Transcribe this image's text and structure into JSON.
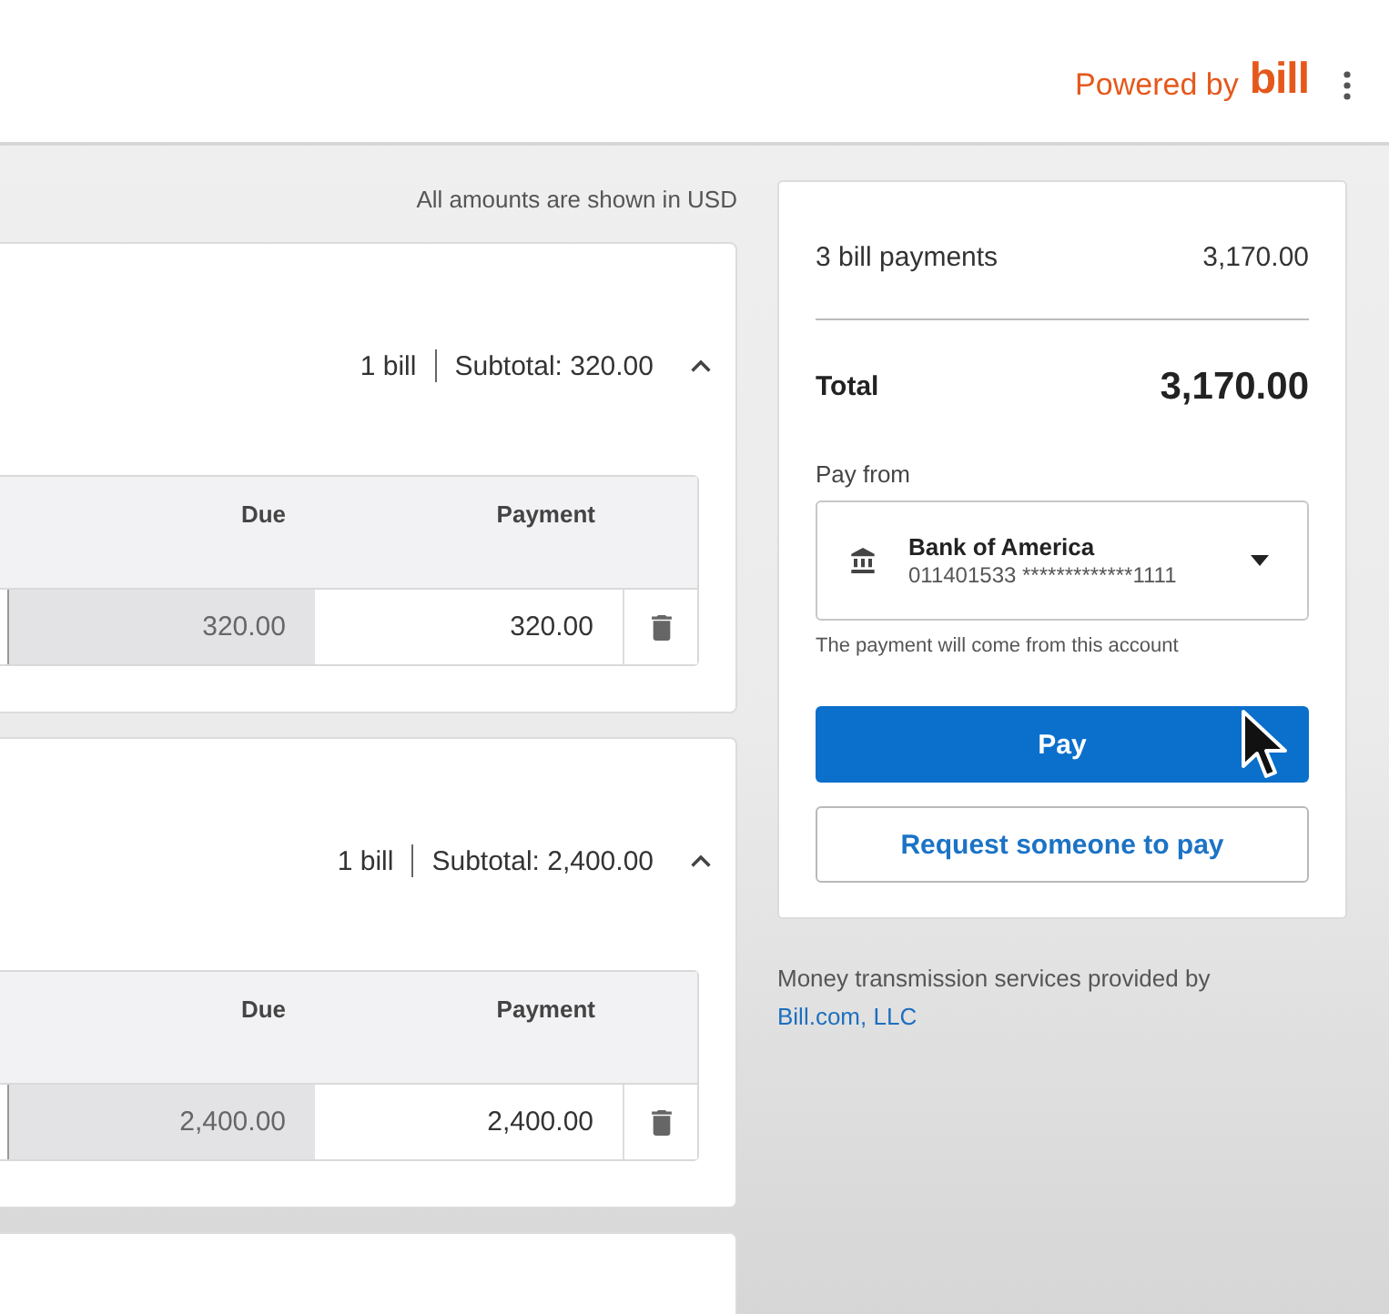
{
  "header": {
    "powered_by": "Powered by",
    "brand": "bill"
  },
  "currency_note": "All amounts are shown in USD",
  "bill_groups": [
    {
      "bill_count": "1 bill",
      "subtotal": "Subtotal: 320.00",
      "expanded": true,
      "columns": [
        "Due",
        "Payment"
      ],
      "rows": [
        {
          "due": "320.00",
          "payment": "320.00"
        }
      ]
    },
    {
      "bill_count": "1 bill",
      "subtotal": "Subtotal: 2,400.00",
      "expanded": true,
      "columns": [
        "Due",
        "Payment"
      ],
      "rows": [
        {
          "due": "2,400.00",
          "payment": "2,400.00"
        }
      ]
    }
  ],
  "summary": {
    "payments_label": "3 bill payments",
    "payments_amount": "3,170.00",
    "total_label": "Total",
    "total_amount": "3,170.00",
    "pay_from_label": "Pay from",
    "account": {
      "bank": "Bank of America",
      "number": "011401533 *************1111"
    },
    "account_hint": "The payment will come from this account",
    "buttons": [
      {
        "label": "Pay",
        "kind": "primary"
      },
      {
        "label": "Request someone to pay",
        "kind": "secondary"
      }
    ]
  },
  "footer": {
    "text": "Money transmission services provided by",
    "link": "Bill.com, LLC"
  }
}
